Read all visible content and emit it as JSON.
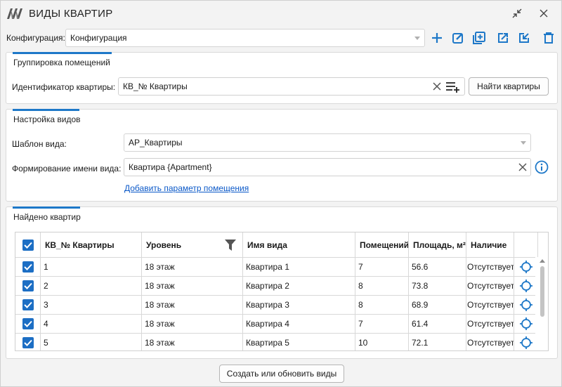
{
  "window": {
    "title": "ВИДЫ КВАРТИР"
  },
  "config": {
    "label": "Конфигурация:",
    "value": "Конфигурация"
  },
  "grouping": {
    "title": "Группировка помещений",
    "id_label": "Идентификатор квартиры:",
    "id_value": "КВ_№ Квартиры",
    "find_button": "Найти квартиры"
  },
  "views": {
    "title": "Настройка видов",
    "template_label": "Шаблон вида:",
    "template_value": "АР_Квартиры",
    "name_label": "Формирование имени вида:",
    "name_value": "Квартира {Apartment}",
    "add_param_link": "Добавить параметр помещения"
  },
  "found": {
    "title": "Найдено квартир",
    "columns": [
      "КВ_№ Квартиры",
      "Уровень",
      "Имя вида",
      "Помещений",
      "Площадь, м²",
      "Наличие"
    ],
    "rows": [
      [
        "1",
        "18 этаж",
        "Квартира 1",
        "7",
        "56.6",
        "Отсутствует"
      ],
      [
        "2",
        "18 этаж",
        "Квартира 2",
        "8",
        "73.8",
        "Отсутствует"
      ],
      [
        "3",
        "18 этаж",
        "Квартира 3",
        "8",
        "68.9",
        "Отсутствует"
      ],
      [
        "4",
        "18 этаж",
        "Квартира 4",
        "7",
        "61.4",
        "Отсутствует"
      ],
      [
        "5",
        "18 этаж",
        "Квартира 5",
        "10",
        "72.1",
        "Отсутствует"
      ]
    ]
  },
  "footer": {
    "create_button": "Создать или обновить виды"
  },
  "colors": {
    "accent": "#1e78c8",
    "link": "#0a58c8",
    "checkbox": "#1c6ec4"
  },
  "icons": [
    "app-logo",
    "collapse-icon",
    "close-icon",
    "plus-icon",
    "edit-icon",
    "duplicate-icon",
    "export-icon",
    "import-icon",
    "trash-icon",
    "clear-icon",
    "list-add-icon",
    "info-icon",
    "filter-icon",
    "locate-icon",
    "check-icon"
  ]
}
